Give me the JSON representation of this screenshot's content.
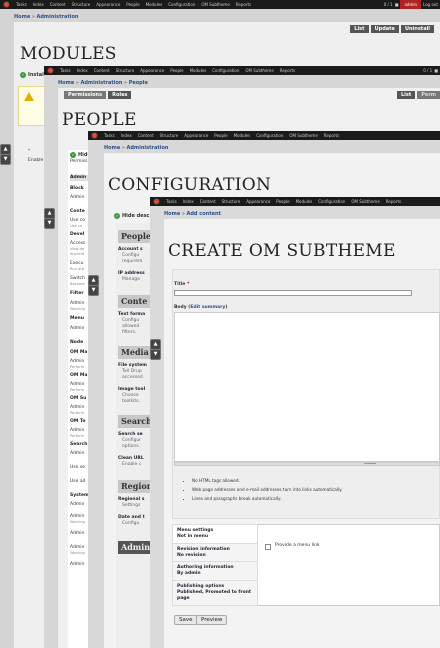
{
  "toolbar": {
    "items": [
      "Tasks",
      "Index",
      "Content",
      "Structure",
      "Appearance",
      "People",
      "Modules",
      "Configuration",
      "OM Subtheme",
      "Reports"
    ],
    "count": "0 / 1",
    "user": "admin",
    "logout": "Log out"
  },
  "l1": {
    "crumb_home": "Home",
    "crumb_sep": " » ",
    "crumb_admin": "Administration",
    "title": "MODULES",
    "tabs": [
      "List",
      "Update",
      "Uninstall"
    ],
    "install": "Install"
  },
  "l2": {
    "crumb_home": "Home",
    "crumb_admin": "Administration",
    "crumb_people": "People",
    "title": "PEOPLE",
    "tabs": [
      "Permissions",
      "Roles"
    ],
    "right_tabs": [
      "List",
      "Perm"
    ],
    "enable": "Enable",
    "col": [
      "Admin",
      "Block",
      "Admin",
      "Conte",
      "Use co",
      "Use co",
      "Devel",
      "Access",
      "View de",
      "Implicat",
      "Execu",
      "Run arb",
      "Switch",
      "Become",
      "Filter",
      "Admin",
      "Warning",
      "Menu",
      "Admin",
      "Node",
      "OM Ma",
      "Admin",
      "Perform",
      "OM Ma",
      "Admin",
      "Perform",
      "OM Su",
      "Admin",
      "Perform",
      "OM To",
      "Admin",
      "Perform",
      "Search",
      "Admin",
      "Use se",
      "Use ad",
      "System",
      "Admin",
      "Admin",
      "Warning",
      "Admin",
      "Admin",
      "Warning",
      "Admin"
    ]
  },
  "l3": {
    "crumb_home": "Home",
    "crumb_admin": "Administration",
    "title": "CONFIGURATION",
    "hide": "Hide",
    "hide_desc": "Hide desc",
    "perms": "Permiss",
    "sections": [
      {
        "h": "People",
        "items": [
          {
            "t": "Account s",
            "d": "Configu requirem"
          },
          {
            "t": "IP address",
            "d": "Manage"
          }
        ]
      },
      {
        "h": "Conte",
        "items": [
          {
            "t": "Text forma",
            "d": "Configu allowed filters."
          }
        ]
      },
      {
        "h": "Media",
        "items": [
          {
            "t": "File system",
            "d": "Tell Drup accessed"
          },
          {
            "t": "Image tool",
            "d": "Choose toolkits."
          }
        ]
      },
      {
        "h": "Search",
        "items": [
          {
            "t": "Search se",
            "d": "Configur options."
          },
          {
            "t": "Clean URL",
            "d": "Enable c"
          }
        ]
      },
      {
        "h": "Region",
        "items": [
          {
            "t": "Regional s",
            "d": "Settings"
          },
          {
            "t": "Date and t",
            "d": "Configu"
          }
        ]
      },
      {
        "h": "Admin",
        "items": []
      }
    ]
  },
  "l4": {
    "crumb_home": "Home",
    "crumb_add": "Add content",
    "title": "CREATE OM SUBTHEME",
    "title_label": "Title",
    "required": "*",
    "body_label": "Body",
    "edit_summary": "Edit summary",
    "tips": [
      "No HTML tags allowed.",
      "Web page addresses and e-mail addresses turn into links automatically.",
      "Lines and paragraphs break automatically."
    ],
    "vtabs": [
      {
        "title": "Menu settings",
        "sub": "Not in menu"
      },
      {
        "title": "Revision information",
        "sub": "No revision"
      },
      {
        "title": "Authoring information",
        "sub": "By admin"
      },
      {
        "title": "Publishing options",
        "sub": "Published, Promoted to front page"
      }
    ],
    "menu_link": "Provide a menu link",
    "save": "Save",
    "preview": "Preview"
  }
}
